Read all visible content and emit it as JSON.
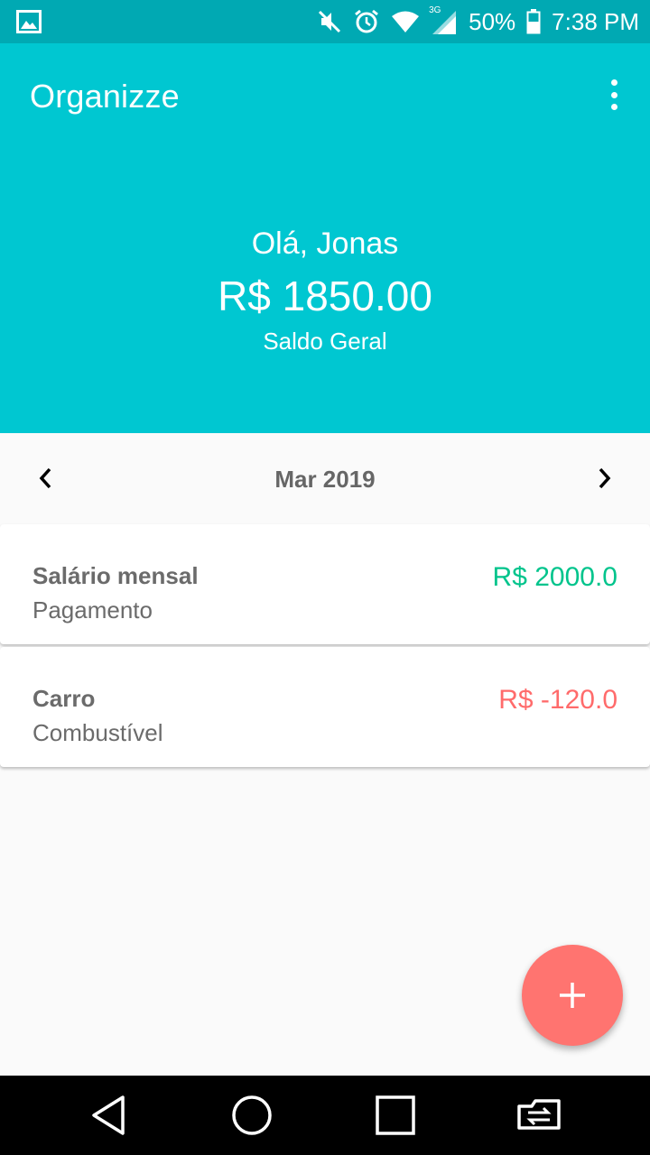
{
  "status_bar": {
    "network": "3G",
    "battery": "50%",
    "time": "7:38 PM"
  },
  "app_bar": {
    "title": "Organizze"
  },
  "summary": {
    "greeting": "Olá, Jonas",
    "balance": "R$ 1850.00",
    "balance_label": "Saldo Geral"
  },
  "month_nav": {
    "label": "Mar 2019"
  },
  "transactions": [
    {
      "title": "Salário mensal",
      "category": "Pagamento",
      "amount": "R$ 2000.0",
      "color": "#00c48c"
    },
    {
      "title": "Carro",
      "category": "Combustível",
      "amount": "R$ -120.0",
      "color": "#ff6b6b"
    }
  ],
  "colors": {
    "primary": "#00c7d1",
    "status_bar": "#00a9b3",
    "fab": "#ff7470",
    "income": "#00c48c",
    "expense": "#ff6b6b"
  },
  "icons": {
    "fab": "plus-icon",
    "back": "back-triangle-icon",
    "home": "home-circle-icon",
    "recents": "recents-square-icon",
    "switch": "switch-app-icon"
  }
}
